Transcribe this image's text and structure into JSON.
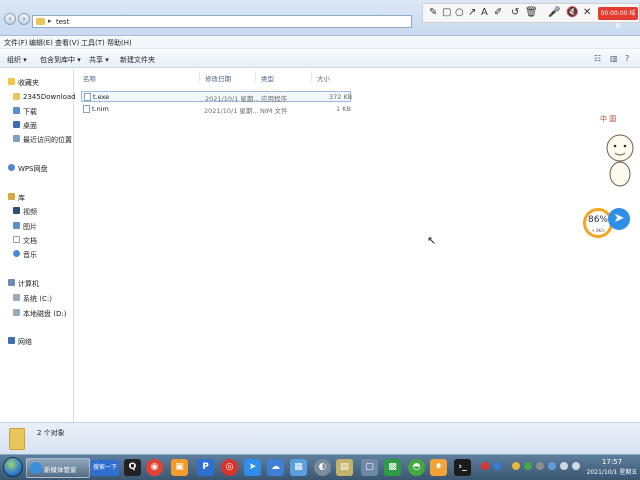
{
  "address": {
    "path": "test"
  },
  "menu": [
    "文件(F)",
    "编辑(E)",
    "查看(V)",
    "工具(T)",
    "帮助(H)"
  ],
  "toolbar": {
    "organize": "组织 ▾",
    "include_library": "包含到库中 ▾",
    "share": "共享 ▾",
    "new_folder": "新建文件夹"
  },
  "nav": {
    "favorites": "收藏夹",
    "fav_items": [
      "2345Downloads",
      "下载",
      "桌面",
      "最近访问的位置"
    ],
    "wps": "WPS网盘",
    "libraries": "库",
    "lib_items": [
      "视频",
      "图片",
      "文档",
      "音乐"
    ],
    "computer": "计算机",
    "comp_items": [
      "系统 (C:)",
      "本地磁盘 (D:)"
    ],
    "network": "网络"
  },
  "columns": {
    "name": "名称",
    "date": "修改日期",
    "type": "类型",
    "size": "大小"
  },
  "files": [
    {
      "name": "t.exe",
      "date": "2021/10/1 星期...",
      "type": "应用程序",
      "size": "372 KB"
    },
    {
      "name": "t.nim",
      "date": "2021/10/1 星期...",
      "type": "NIM 文件",
      "size": "1 KB"
    }
  ],
  "status": {
    "count": "2 个对象"
  },
  "recorder": {
    "timer": "00:00:00 结束"
  },
  "widget": {
    "percent": "86%",
    "speed": "+ 0K/s"
  },
  "sticker_text": "中 国",
  "taskbar": {
    "ie_label": "新媒体管家",
    "search": "搜索一下"
  },
  "clock": {
    "time": "17:57",
    "date": "2021/10/1 星期五"
  }
}
